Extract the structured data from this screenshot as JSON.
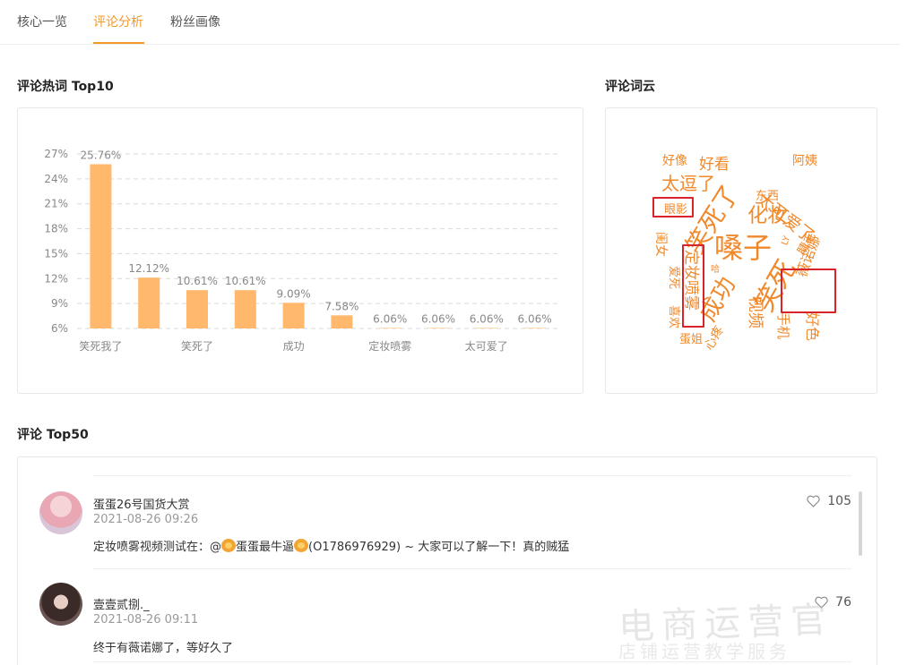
{
  "tabs": [
    {
      "label": "核心一览",
      "active": false
    },
    {
      "label": "评论分析",
      "active": true
    },
    {
      "label": "粉丝画像",
      "active": false
    }
  ],
  "hotwords": {
    "title": "评论热词 Top10",
    "chart_data": {
      "type": "bar",
      "categories": [
        "笑死我了",
        "",
        "笑死了",
        "",
        "成功",
        "",
        "定妆喷雾",
        "",
        "太可爱了",
        ""
      ],
      "values": [
        25.76,
        12.12,
        10.61,
        10.61,
        9.09,
        7.58,
        6.06,
        6.06,
        6.06,
        6.06
      ],
      "value_labels": [
        "25.76%",
        "12.12%",
        "10.61%",
        "10.61%",
        "9.09%",
        "7.58%",
        "6.06%",
        "6.06%",
        "6.06%",
        "6.06%"
      ],
      "yticks": [
        "6%",
        "9%",
        "12%",
        "15%",
        "18%",
        "21%",
        "24%",
        "27%"
      ],
      "ylim": [
        6,
        27
      ],
      "grid": true,
      "bar_color": "#ffb86c"
    }
  },
  "wordcloud": {
    "title": "评论词云",
    "words": [
      "好像",
      "好看",
      "太可爱了",
      "阿姨",
      "太逗了",
      "笑死了",
      "东西",
      "眼影",
      "化妆",
      "睫毛",
      "嗓子",
      "LY",
      "闺女",
      "定妆喷雾",
      "成功",
      "笑死",
      "薇诺娜",
      "爱死",
      "喜欢",
      "手机",
      "视频",
      "心疼",
      "蛋姐",
      "哈",
      "好色"
    ]
  },
  "comments": {
    "title": "评论 Top50",
    "items": [
      {
        "name": "蛋蛋26号国货大赏",
        "time": "2021-08-26 09:26",
        "text_before": "定妆喷雾视频测试在：@",
        "mention": "蛋蛋最牛逼",
        "text_after": "(O1786976929) ~ 大家可以了解一下！真的贼猛",
        "likes": "105"
      },
      {
        "name": "壹壹贰捌._",
        "time": "2021-08-26 09:11",
        "text": "终于有薇诺娜了，等好久了",
        "likes": "76"
      }
    ]
  },
  "watermark": {
    "main": "电商运营官",
    "sub": "店铺运营教学服务"
  }
}
